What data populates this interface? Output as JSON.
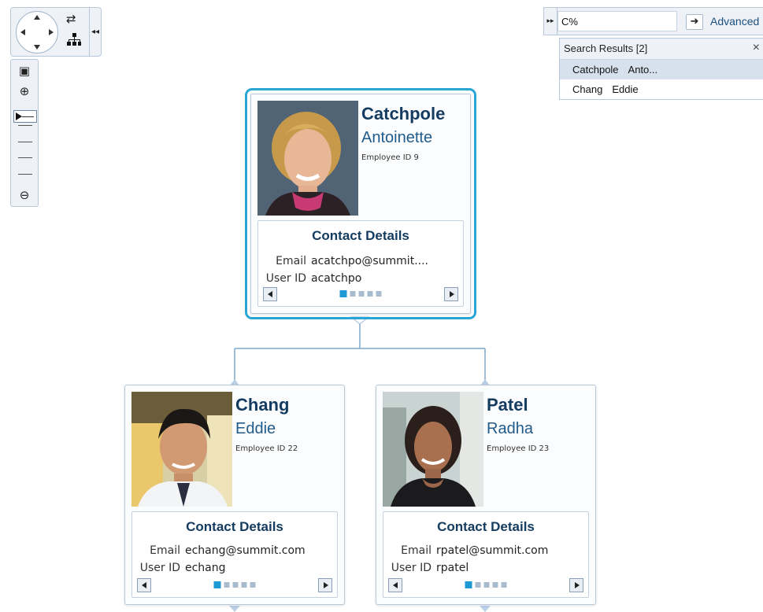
{
  "controls": {
    "zoom_level_fraction": 0.2
  },
  "search": {
    "query": "C%",
    "advanced_label": "Advanced",
    "results_title": "Search Results [2]",
    "close_symbol": "×",
    "results": [
      {
        "last": "Catchpole",
        "first": "Anto..."
      },
      {
        "last": "Chang",
        "first": "Eddie"
      }
    ]
  },
  "cards": [
    {
      "last_name": "Catchpole",
      "first_name": "Antoinette",
      "employee_id": "Employee ID 9",
      "details_title": "Contact Details",
      "email_label": "Email",
      "email": "acatchpo@summit....",
      "userid_label": "User ID",
      "userid": "acatchpo"
    },
    {
      "last_name": "Chang",
      "first_name": "Eddie",
      "employee_id": "Employee ID 22",
      "details_title": "Contact Details",
      "email_label": "Email",
      "email": "echang@summit.com",
      "userid_label": "User ID",
      "userid": "echang"
    },
    {
      "last_name": "Patel",
      "first_name": "Radha",
      "employee_id": "Employee ID 23",
      "details_title": "Contact Details",
      "email_label": "Email",
      "email": "rpatel@summit.com",
      "userid_label": "User ID",
      "userid": "rpatel"
    }
  ],
  "colors": {
    "accent": "#2aa6d6",
    "heading": "#143c60",
    "name": "#1f5b8b",
    "connector": "#7ea8cc"
  }
}
